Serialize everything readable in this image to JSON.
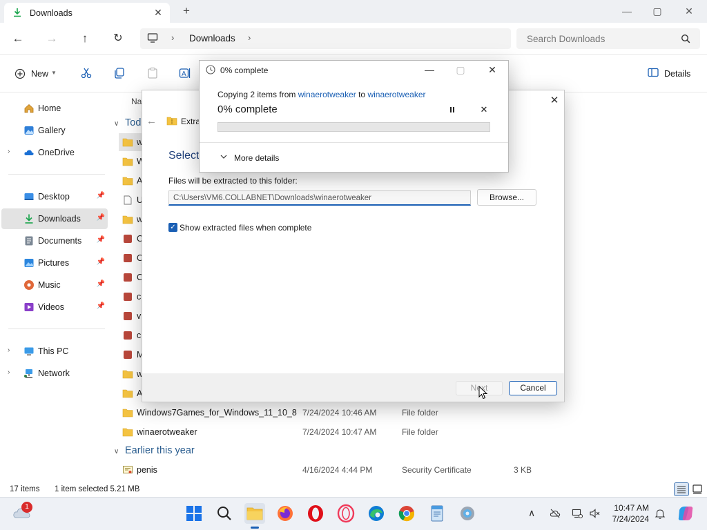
{
  "window": {
    "tab_title": "Downloads",
    "controls": {
      "minimize": "—",
      "maximize": "▢",
      "close": "✕"
    }
  },
  "address": {
    "breadcrumb": [
      "Downloads"
    ],
    "search_placeholder": "Search Downloads"
  },
  "toolbar": {
    "new_label": "New",
    "details_label": "Details"
  },
  "sidebar": {
    "items": [
      {
        "label": "Home",
        "icon": "home-icon"
      },
      {
        "label": "Gallery",
        "icon": "gallery-icon"
      },
      {
        "label": "OneDrive",
        "icon": "cloud-icon"
      },
      {
        "label": "Desktop",
        "icon": "desktop-icon"
      },
      {
        "label": "Downloads",
        "icon": "download-icon"
      },
      {
        "label": "Documents",
        "icon": "document-icon"
      },
      {
        "label": "Pictures",
        "icon": "pictures-icon"
      },
      {
        "label": "Music",
        "icon": "music-icon"
      },
      {
        "label": "Videos",
        "icon": "videos-icon"
      },
      {
        "label": "This PC",
        "icon": "computer-icon"
      },
      {
        "label": "Network",
        "icon": "network-icon"
      }
    ]
  },
  "filelist": {
    "column_name_partial": "Na",
    "group_today_partial": "Tod",
    "group_earlier": "Earlier this year",
    "partial_rows": [
      "w",
      "W",
      "A",
      "U",
      "w",
      "O",
      "O",
      "C",
      "c",
      "vl",
      "c",
      "M",
      "w",
      "A"
    ],
    "rows": [
      {
        "name": "Windows7Games_for_Windows_11_10_8",
        "date": "7/24/2024 10:46 AM",
        "type": "File folder",
        "size": ""
      },
      {
        "name": "winaerotweaker",
        "date": "7/24/2024 10:47 AM",
        "type": "File folder",
        "size": ""
      },
      {
        "name": "penis",
        "date": "4/16/2024 4:44 PM",
        "type": "Security Certificate",
        "size": "3 KB"
      }
    ]
  },
  "status": {
    "count": "17 items",
    "selection": "1 item selected  5.21 MB"
  },
  "wizard": {
    "title_partial": "Extra",
    "heading_partial": "Select",
    "dest_label": "Files will be extracted to this folder:",
    "path": "C:\\Users\\VM6.COLLABNET\\Downloads\\winaerotweaker",
    "browse_label": "Browse...",
    "show_files_label": "Show extracted files when complete",
    "show_files_checked": true,
    "next_label": "Next",
    "cancel_label": "Cancel",
    "close": "✕"
  },
  "copy": {
    "title": "0% complete",
    "desc_prefix": "Copying 2 items from ",
    "source": "winaerotweaker",
    "desc_mid": " to ",
    "destination": "winaerotweaker",
    "percent_label": "0% complete",
    "progress": 0.0,
    "more_details": "More details",
    "controls": {
      "minimize": "—",
      "maximize": "▢",
      "close": "✕"
    },
    "cancel": "✕"
  },
  "taskbar": {
    "weather_badge": "1",
    "time": "10:47 AM",
    "date": "7/24/2024",
    "apps": [
      "start-icon",
      "search-icon",
      "file-explorer-icon",
      "firefox-icon",
      "opera-icon",
      "opera-gx-icon",
      "edge-icon",
      "chrome-icon",
      "notepad-icon",
      "settings-app-icon"
    ]
  },
  "colors": {
    "accent": "#1a5fb4",
    "folder": "#f4c342",
    "progress": "#06b025"
  }
}
